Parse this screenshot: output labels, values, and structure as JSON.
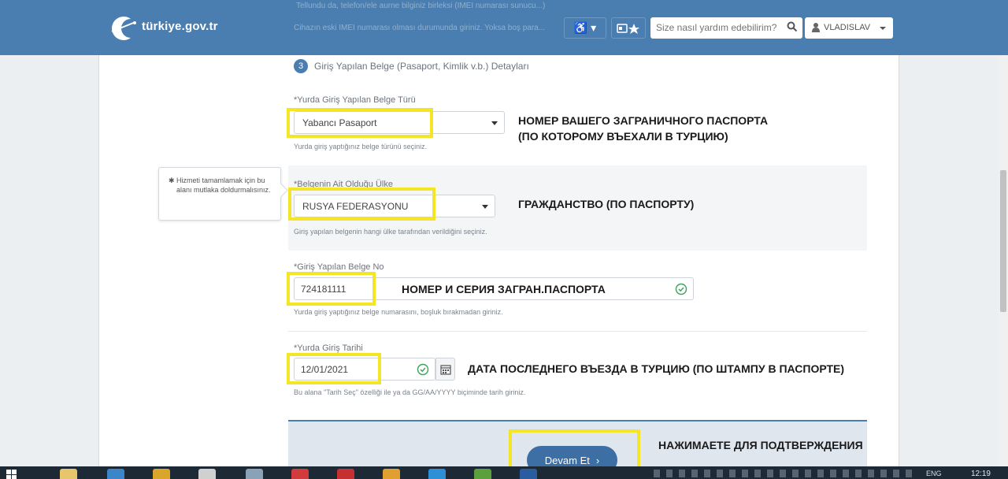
{
  "header": {
    "logo_text": "türkiye.gov.tr",
    "ghost_line1": "Tellundu da, telefon/ele aurne bilginiz birleksi (IMEI numarası sunucu...)",
    "ghost_line2": "Cihazın eski IMEI numarası olması durumunda giriniz. Yoksa boş para...",
    "accessibility_label": "♿ ▾",
    "search_placeholder": "Size nasıl yardım edebilirim?",
    "user_name": "VLADISLAV",
    "colors": {
      "header_bg": "#4a7eb0",
      "highlight": "#f4e626"
    }
  },
  "section": {
    "step": "3",
    "title": "Giriş Yapılan Belge (Pasaport, Kimlik v.b.) Detayları"
  },
  "fields": {
    "doc_type": {
      "label": "*Yurda Giriş Yapılan Belge Türü",
      "value": "Yabancı Pasaport",
      "help": "Yurda giriş yaptığınız belge türünü seçiniz."
    },
    "country": {
      "label": "*Belgenin Ait Olduğu Ülke",
      "value": "RUSYA FEDERASYONU",
      "help": "Giriş yapılan belgenin hangi ülke tarafından verildiğini seçiniz."
    },
    "doc_no": {
      "label": "*Giriş Yapılan Belge No",
      "value": "724181111",
      "help": "Yurda giriş yaptığınız belge numarasını, boşluk bırakmadan giriniz."
    },
    "entry_date": {
      "label": "*Yurda Giriş Tarihi",
      "value": "12/01/2021",
      "help": "Bu alana \"Tarih Seç\" özelliği ile ya da GG/AA/YYYY biçiminde tarih giriniz."
    }
  },
  "tooltip": {
    "star": "✱",
    "text": "Hizmeti tamamlamak için bu alanı mutlaka doldurmalısınız."
  },
  "annotations": {
    "doc_type_line1": "НОМЕР ВАШЕГО ЗАГРАНИЧНОГО ПАСПОРТА",
    "doc_type_line2": "(ПО КОТОРОМУ ВЪЕХАЛИ В ТУРЦИЮ)",
    "country": "ГРАЖДАНСТВО (ПО ПАСПОРТУ)",
    "doc_no": "НОМЕР И СЕРИЯ ЗАГРАН.ПАСПОРТА",
    "entry_date": "ДАТА ПОСЛЕДНЕГО ВЪЕЗДА В ТУРЦИЮ (ПО ШТАМПУ В ПАСПОРТЕ)",
    "continue": "НАЖИМАЕТЕ ДЛЯ ПОДТВЕРЖДЕНИЯ"
  },
  "buttons": {
    "continue": "Devam Et"
  },
  "taskbar": {
    "time": "12:19",
    "lang": "ENG"
  }
}
